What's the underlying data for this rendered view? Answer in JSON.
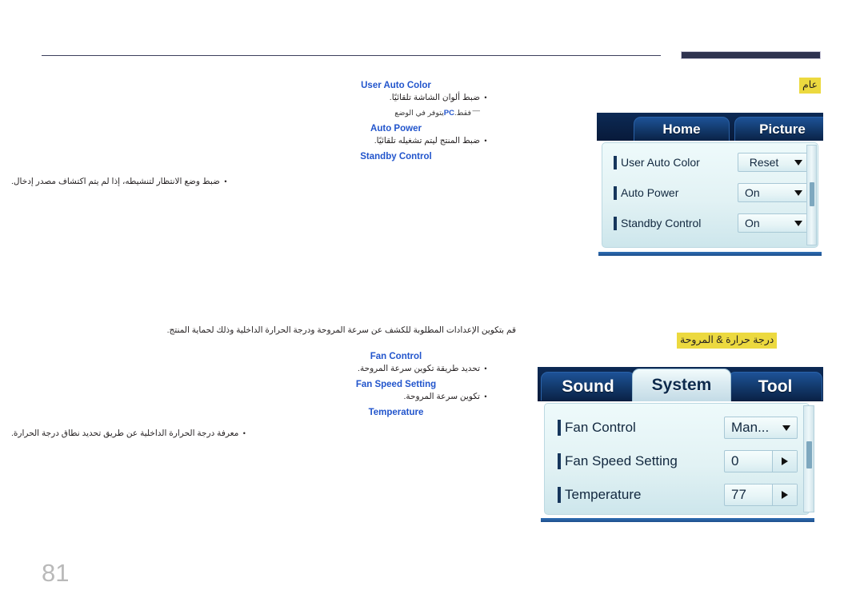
{
  "page": {
    "number": "81",
    "language": "ar"
  },
  "sections": [
    {
      "tag": "عام",
      "options": [
        {
          "title": "User Auto Color",
          "bullets": [
            "ضبط ألوان الشاشة تلقائيًا."
          ],
          "note": {
            "prefix": "يتوفر في الوضع ",
            "emphasis": "PC",
            "suffix": " فقط."
          }
        },
        {
          "title": "Auto Power",
          "bullets": [
            "ضبط المنتج ليتم تشغيله تلقائيًا."
          ]
        },
        {
          "title": "Standby Control",
          "bullets": [
            "ضبط وضع الانتظار لتنشيطه، إذا لم يتم اكتشاف مصدر إدخال."
          ]
        }
      ]
    },
    {
      "tag": "درجة حرارة & المروحة",
      "intro": "قم بتكوين الإعدادات المطلوبة للكشف عن سرعة المروحة ودرجة الحرارة الداخلية وذلك لحماية المنتج.",
      "options": [
        {
          "title": "Fan Control",
          "bullets": [
            "تحديد طريقة تكوين سرعة المروحة."
          ]
        },
        {
          "title": "Fan Speed Setting",
          "bullets": [
            "تكوين سرعة المروحة."
          ]
        },
        {
          "title": "Temperature",
          "bullets": [
            "معرفة درجة الحرارة الداخلية عن طريق تحديد نطاق درجة الحرارة."
          ]
        }
      ]
    }
  ],
  "osd_home": {
    "tabs": [
      {
        "label": "Home",
        "active": false
      },
      {
        "label": "Picture",
        "active": false
      }
    ],
    "rows": [
      {
        "label": "User Auto Color",
        "value": "Reset",
        "control": "dropdown"
      },
      {
        "label": "Auto Power",
        "value": "On",
        "control": "dropdown"
      },
      {
        "label": "Standby Control",
        "value": "On",
        "control": "dropdown"
      }
    ]
  },
  "osd_system": {
    "tabs": [
      {
        "label": "Sound",
        "active": false
      },
      {
        "label": "System",
        "active": true
      },
      {
        "label": "Tool",
        "active": false
      }
    ],
    "rows": [
      {
        "label": "Fan Control",
        "value": "Man...",
        "control": "dropdown"
      },
      {
        "label": "Fan Speed Setting",
        "value": "0",
        "control": "stepper"
      },
      {
        "label": "Temperature",
        "value": "77",
        "control": "stepper"
      }
    ]
  },
  "colors": {
    "highlight": "#ecd93f",
    "option_title": "#2255cc",
    "rule_dark": "#2e3250",
    "page_number": "#b9b9b9"
  },
  "icons": {
    "dropdown": "chevron-down-icon",
    "stepper": "chevron-right-icon",
    "bullet": "bullet-dot-icon"
  }
}
